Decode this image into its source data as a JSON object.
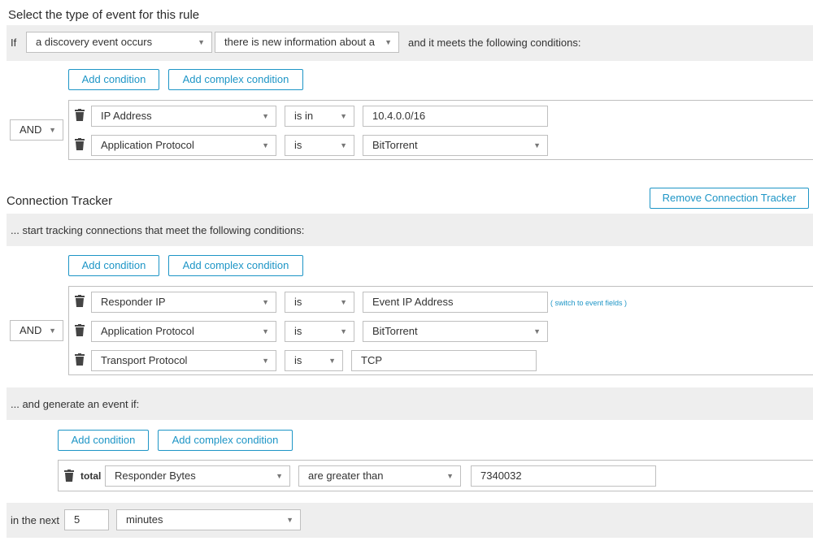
{
  "rule": {
    "heading": "Select the type of event for this rule",
    "if_label": "If",
    "event_select": "a discovery event occurs",
    "info_select": "there is new information about a",
    "meets_text": "and it meets the following conditions:",
    "add_condition": "Add condition",
    "add_complex_condition": "Add complex condition",
    "operator": "AND",
    "conditions": [
      {
        "field": "IP Address",
        "op": "is in",
        "value": "10.4.0.0/16"
      },
      {
        "field": "Application Protocol",
        "op": "is",
        "value": "BitTorrent"
      }
    ]
  },
  "tracker": {
    "heading": "Connection Tracker",
    "remove_button": "Remove Connection Tracker",
    "start_text": "... start tracking connections that meet the following conditions:",
    "add_condition": "Add condition",
    "add_complex_condition": "Add complex condition",
    "operator": "AND",
    "conditions": [
      {
        "field": "Responder IP",
        "op": "is",
        "value": "Event IP Address"
      },
      {
        "field": "Application Protocol",
        "op": "is",
        "value": "BitTorrent"
      },
      {
        "field": "Transport Protocol",
        "op": "is",
        "value": "TCP"
      }
    ],
    "switch_link": "( switch to event fields )"
  },
  "generate": {
    "text": "... and generate an event if:",
    "add_condition": "Add condition",
    "add_complex_condition": "Add complex condition",
    "total_label": "total",
    "field": "Responder Bytes",
    "op": "are greater than",
    "value": "7340032",
    "in_the_next": "in the next",
    "window_value": "5",
    "window_unit": "minutes"
  },
  "icons": {
    "trash": "trash-icon",
    "dropdown": "chevron-down-icon"
  },
  "colors": {
    "accent": "#1d95c6",
    "band": "#eeeeee",
    "border": "#bfbfbf"
  }
}
